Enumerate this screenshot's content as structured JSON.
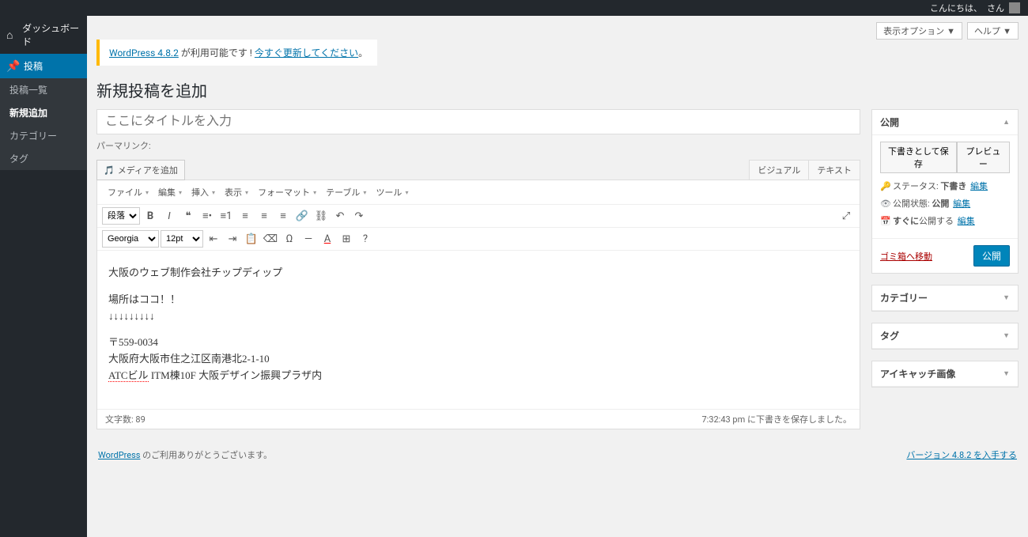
{
  "adminbar": {
    "greeting": "こんにちは、",
    "account": "さん"
  },
  "sidebar": {
    "dashboard": "ダッシュボード",
    "posts": "投稿",
    "submenu": {
      "list": "投稿一覧",
      "add": "新規追加",
      "categories": "カテゴリー",
      "tags": "タグ"
    }
  },
  "topactions": {
    "options": "表示オプション ▼",
    "help": "ヘルプ ▼"
  },
  "notice": {
    "text1": "WordPress 4.8.2",
    "text2": " が利用可能です ! ",
    "text3": "今すぐ更新してください",
    "text4": "。"
  },
  "page": {
    "title": "新規投稿を追加"
  },
  "editor": {
    "title_placeholder": "ここにタイトルを入力",
    "permalink_label": "パーマリンク:",
    "media_btn": "メディアを追加",
    "tabs": {
      "visual": "ビジュアル",
      "text": "テキスト"
    },
    "menubar": {
      "file": "ファイル",
      "edit": "編集",
      "insert": "挿入",
      "view": "表示",
      "format": "フォーマット",
      "table": "テーブル",
      "tools": "ツール"
    },
    "format_select": "段落",
    "font_select": "Georgia",
    "size_select": "12pt",
    "content": {
      "p1": "大阪のウェブ制作会社チップディップ",
      "p2a": "場所はココ！！",
      "p2b": "↓↓↓↓↓↓↓↓↓",
      "p3a": "〒559-0034",
      "p3b": "大阪府大阪市住之江区南港北2-1-10",
      "p3c_err": "ATCビル",
      "p3c_rest": " ITM棟10F 大阪デザイン振興プラザ内"
    },
    "status": {
      "wordcount": "文字数: 89",
      "saved": "7:32:43 pm に下書きを保存しました。"
    }
  },
  "publish_box": {
    "title": "公開",
    "save_draft": "下書きとして保存",
    "preview": "プレビュー",
    "status_label": "ステータス:",
    "status_value": "下書き",
    "edit": "編集",
    "visibility_label": "公開状態:",
    "visibility_value": "公開",
    "schedule_label": "すぐに",
    "schedule_suffix": "公開する",
    "trash": "ゴミ箱へ移動",
    "publish_btn": "公開"
  },
  "metaboxes": {
    "categories": "カテゴリー",
    "tags": "タグ",
    "featured": "アイキャッチ画像"
  },
  "footer": {
    "thanks_link": "WordPress",
    "thanks_text": " のご利用ありがとうございます。",
    "version": "バージョン 4.8.2 を入手する"
  }
}
